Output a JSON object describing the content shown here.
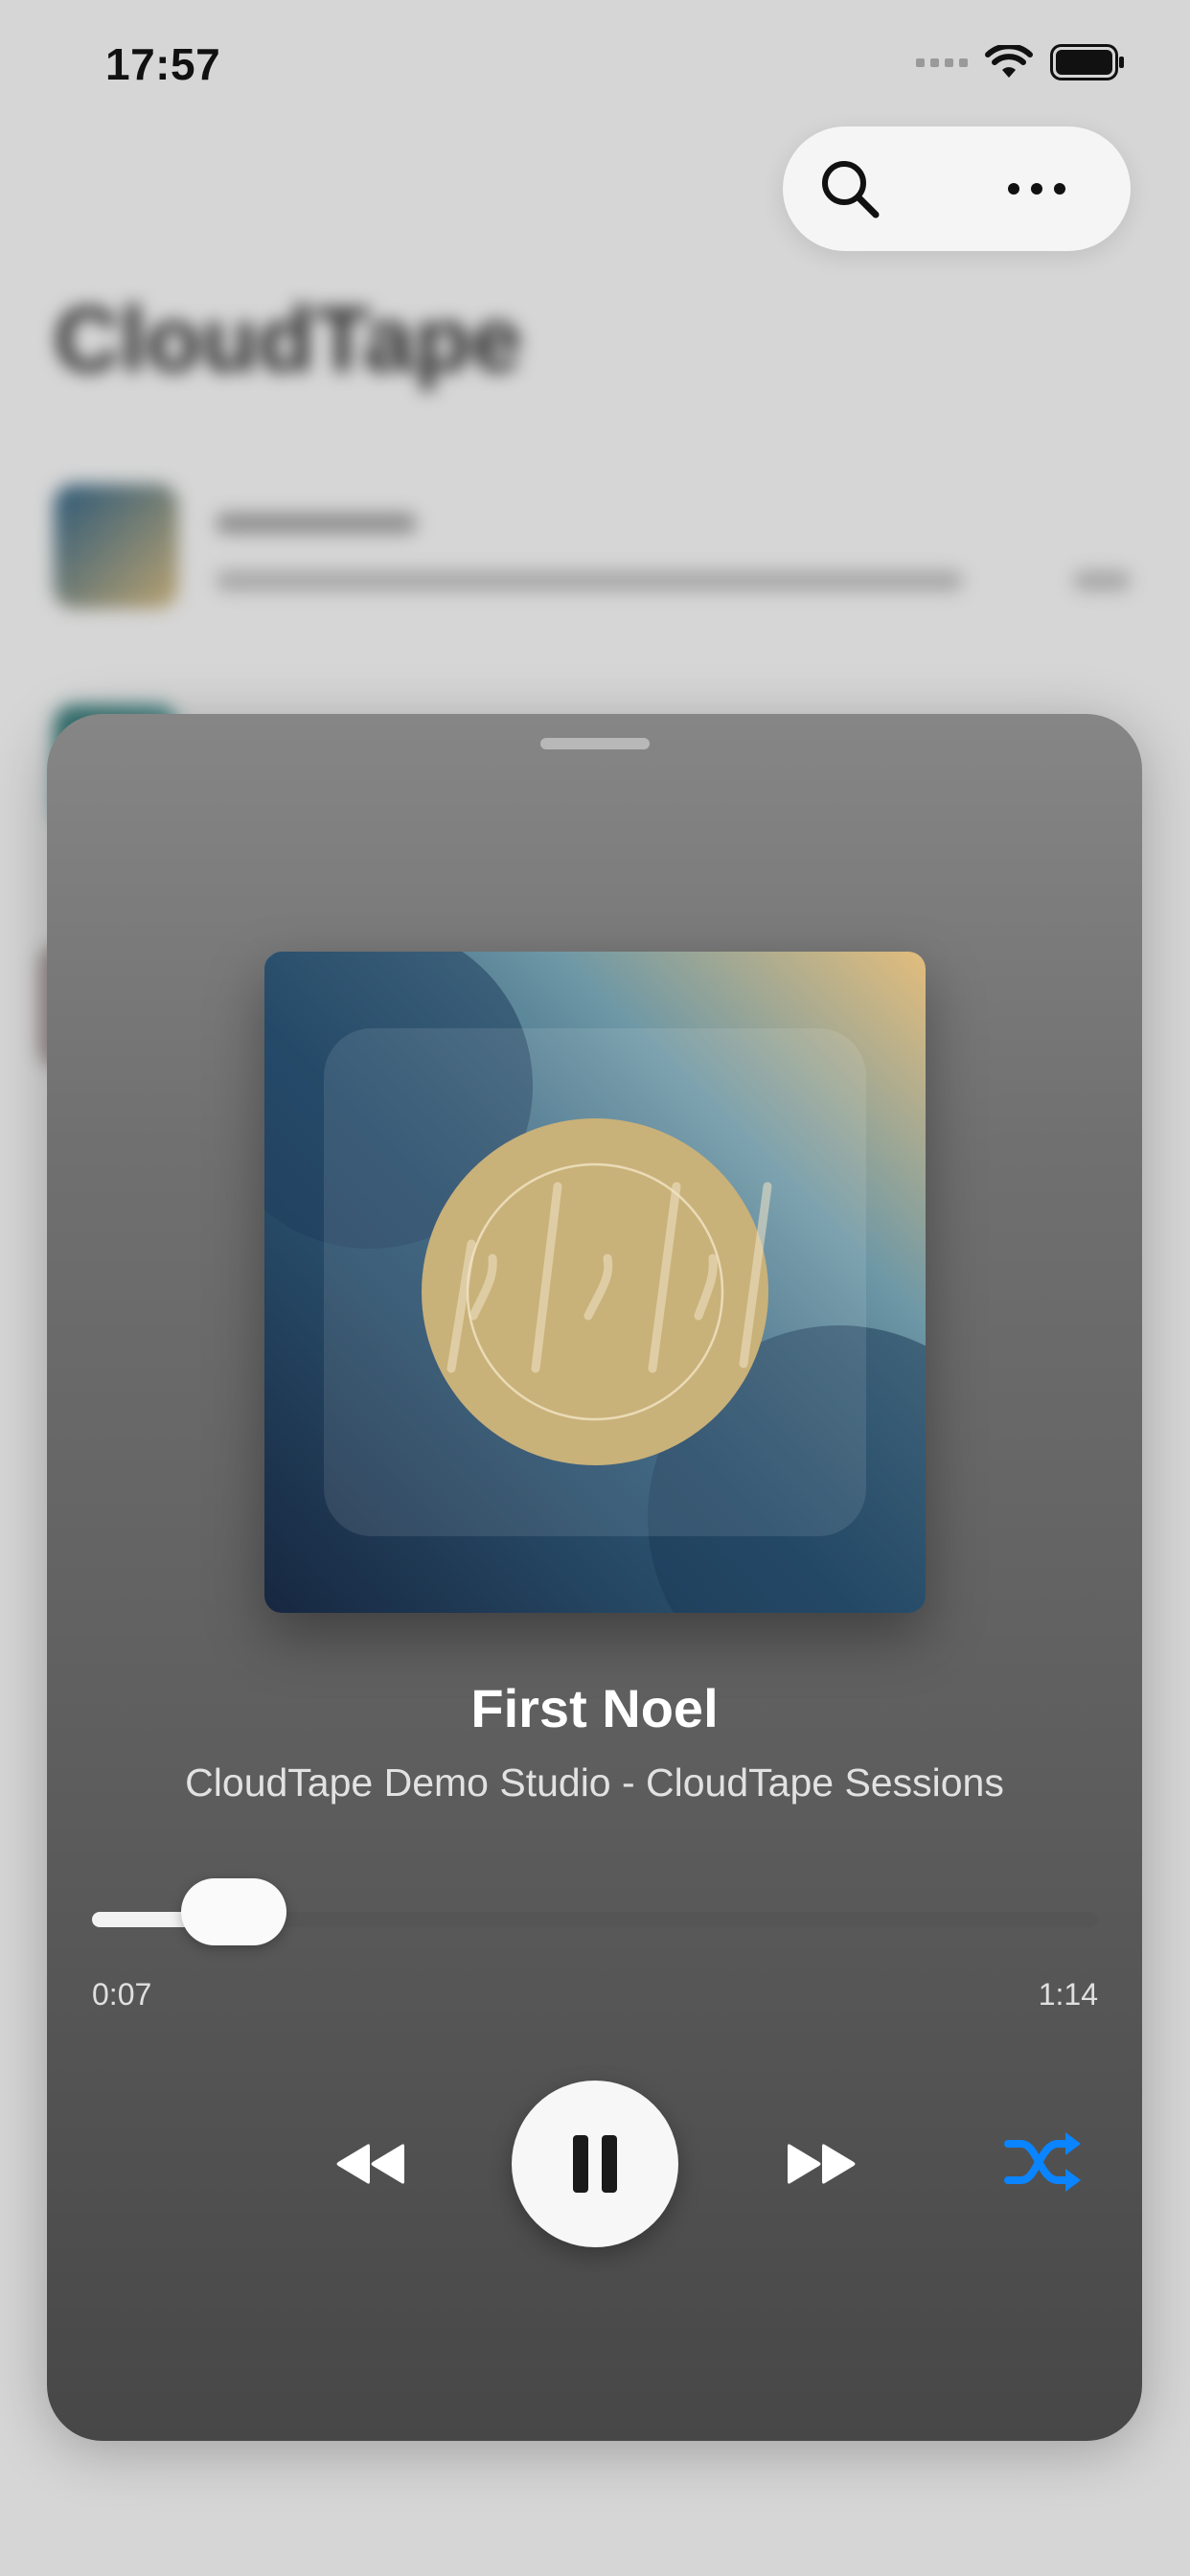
{
  "status_bar": {
    "time": "17:57"
  },
  "background": {
    "app_title": "CloudTape"
  },
  "player": {
    "title": "First Noel",
    "subtitle": "CloudTape Demo Studio - CloudTape Sessions",
    "elapsed": "0:07",
    "duration": "1:14",
    "progress_fraction": 0.095,
    "shuffle_active": true
  },
  "colors": {
    "accent": "#0a84ff",
    "sheet_top": "#868686",
    "sheet_bottom": "#474747",
    "artwork_gold": "#c9b17a",
    "artwork_navy": "#1e3a55"
  },
  "icons": {
    "search": "search-icon",
    "more": "ellipsis-icon",
    "rewind": "rewind-icon",
    "pause": "pause-icon",
    "forward": "fast-forward-icon",
    "shuffle": "shuffle-icon"
  }
}
